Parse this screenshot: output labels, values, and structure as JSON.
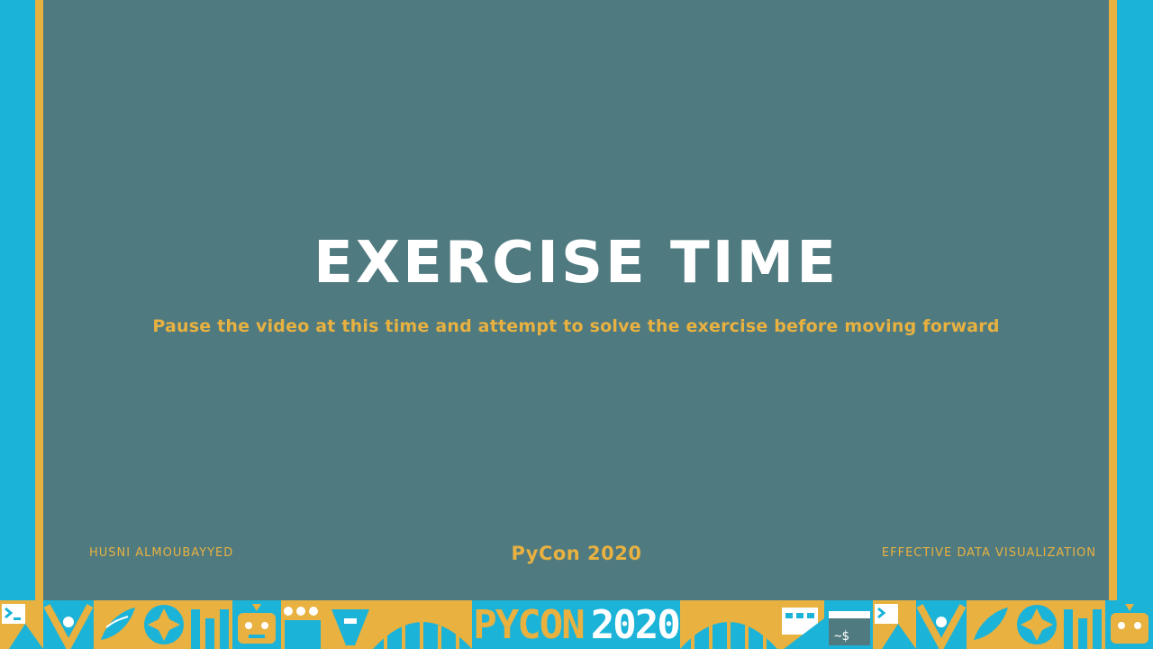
{
  "slide": {
    "title": "EXERCISE TIME",
    "subtitle": "Pause the video at this time and attempt to solve the exercise before moving forward"
  },
  "footer": {
    "author": "HUSNI ALMOUBAYYED",
    "conference": "PyCon 2020",
    "talk": "EFFECTIVE DATA VISUALIZATION"
  },
  "banner": {
    "label_left": "PYCON",
    "label_right": "2020"
  },
  "colors": {
    "background": "#4f7a80",
    "accent": "#e8b140",
    "frame": "#1cb3d8",
    "title": "#ffffff"
  }
}
